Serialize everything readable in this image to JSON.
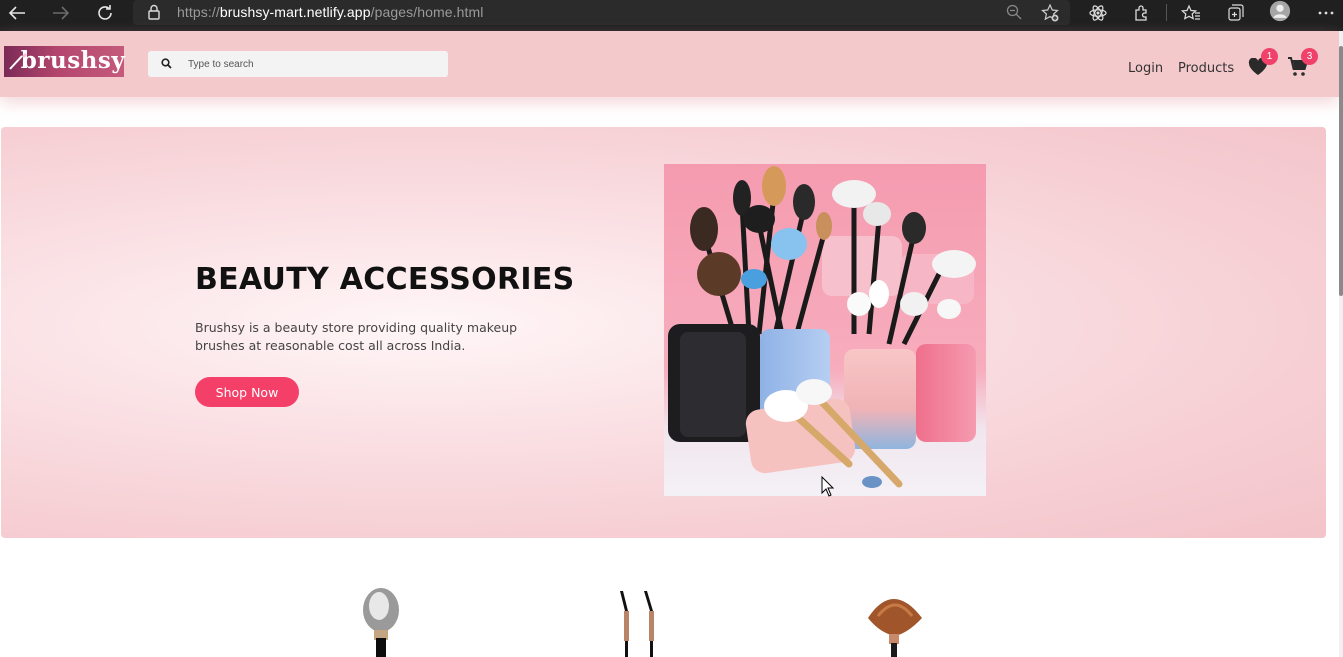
{
  "browser": {
    "url_scheme": "https://",
    "url_host": "brushsy-mart.netlify.app",
    "url_path": "/pages/home.html"
  },
  "header": {
    "logo_text": "brushsy",
    "search_placeholder": "Type to search",
    "nav": {
      "login": "Login",
      "products": "Products"
    },
    "wishlist_count": "1",
    "cart_count": "3"
  },
  "hero": {
    "title": "BEAUTY ACCESSORIES",
    "description": "Brushsy is a beauty store providing quality makeup brushes at reasonable cost all across India.",
    "cta": "Shop Now"
  },
  "colors": {
    "header_bg": "#f4c9cb",
    "accent": "#f43f68",
    "badge": "#f0416a"
  },
  "icons": [
    "back-icon",
    "forward-icon",
    "refresh-icon",
    "lock-icon",
    "zoom-icon",
    "favorite-add-icon",
    "react-devtools-icon",
    "extensions-icon",
    "favorites-icon",
    "collections-icon",
    "profile-icon",
    "more-icon",
    "search-icon",
    "heart-icon",
    "cart-icon"
  ]
}
